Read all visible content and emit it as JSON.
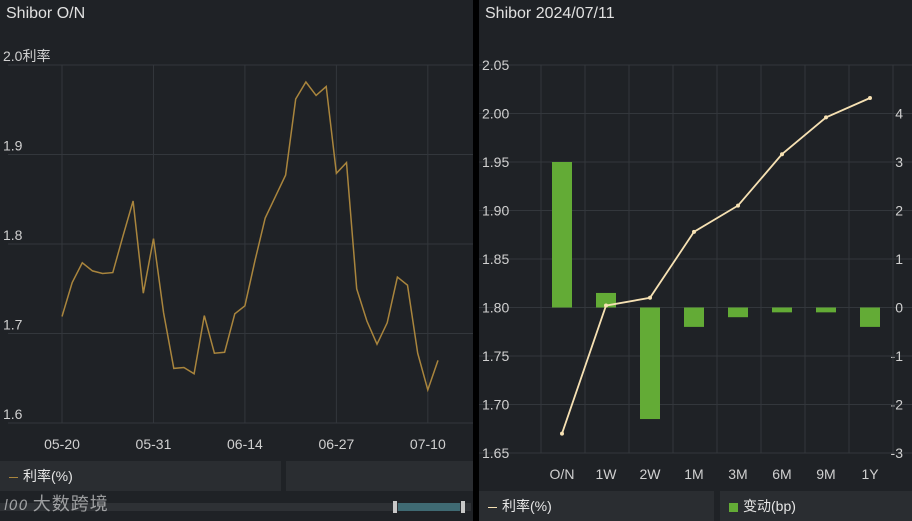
{
  "left": {
    "title": "Shibor O/N",
    "legend_label": "利率(%)",
    "watermark_text": "大数跨境",
    "watermark_logo": "l00"
  },
  "right": {
    "title": "Shibor 2024/07/11",
    "legend_rate": "利率(%)",
    "legend_change": "变动(bp)"
  },
  "colors": {
    "line_left": "#a9853d",
    "line_right": "#f6e1b3",
    "bar": "#63ab36",
    "grid": "#33373c",
    "axis_text": "#d0d0d0"
  },
  "chart_data": [
    {
      "type": "line",
      "ylabel": "利率",
      "ylim": [
        1.6,
        2.0
      ],
      "yticks": [
        1.6,
        1.7,
        1.8,
        1.9,
        2.0
      ],
      "xtick_labels": [
        "05-20",
        "05-31",
        "06-14",
        "06-27",
        "07-10"
      ],
      "xtick_index": [
        0,
        9,
        18,
        27,
        36
      ],
      "grid": true,
      "legend_position": "bottom-left",
      "series": [
        {
          "name": "利率(%)",
          "values": [
            1.719,
            1.757,
            1.779,
            1.77,
            1.767,
            1.768,
            1.809,
            1.848,
            1.745,
            1.806,
            1.723,
            1.661,
            1.662,
            1.655,
            1.72,
            1.678,
            1.679,
            1.722,
            1.731,
            1.782,
            1.829,
            1.853,
            1.877,
            1.962,
            1.981,
            1.966,
            1.976,
            1.879,
            1.891,
            1.75,
            1.714,
            1.688,
            1.712,
            1.763,
            1.754,
            1.678,
            1.637,
            1.67
          ]
        }
      ]
    },
    {
      "type": "bar+line",
      "categories": [
        "O/N",
        "1W",
        "2W",
        "1M",
        "3M",
        "6M",
        "9M",
        "1Y"
      ],
      "y_left": {
        "lim": [
          1.65,
          2.05
        ],
        "ticks": [
          "1.65",
          "1.70",
          "1.75",
          "1.80",
          "1.85",
          "1.90",
          "1.95",
          "2.00",
          "2.05"
        ]
      },
      "y_right": {
        "lim": [
          -3,
          5
        ],
        "ticks": [
          "-3",
          "-2",
          "-1",
          "0",
          "1",
          "2",
          "3",
          "4"
        ]
      },
      "grid": true,
      "legend_position": "bottom",
      "series": [
        {
          "name": "利率(%)",
          "type": "line",
          "axis": "left",
          "values": [
            1.67,
            1.802,
            1.81,
            1.878,
            1.905,
            1.958,
            1.996,
            2.016
          ]
        },
        {
          "name": "变动(bp)",
          "type": "bar",
          "axis": "right",
          "values": [
            3.0,
            0.3,
            -2.3,
            -0.4,
            -0.2,
            -0.1,
            -0.1,
            -0.4
          ]
        }
      ]
    }
  ]
}
